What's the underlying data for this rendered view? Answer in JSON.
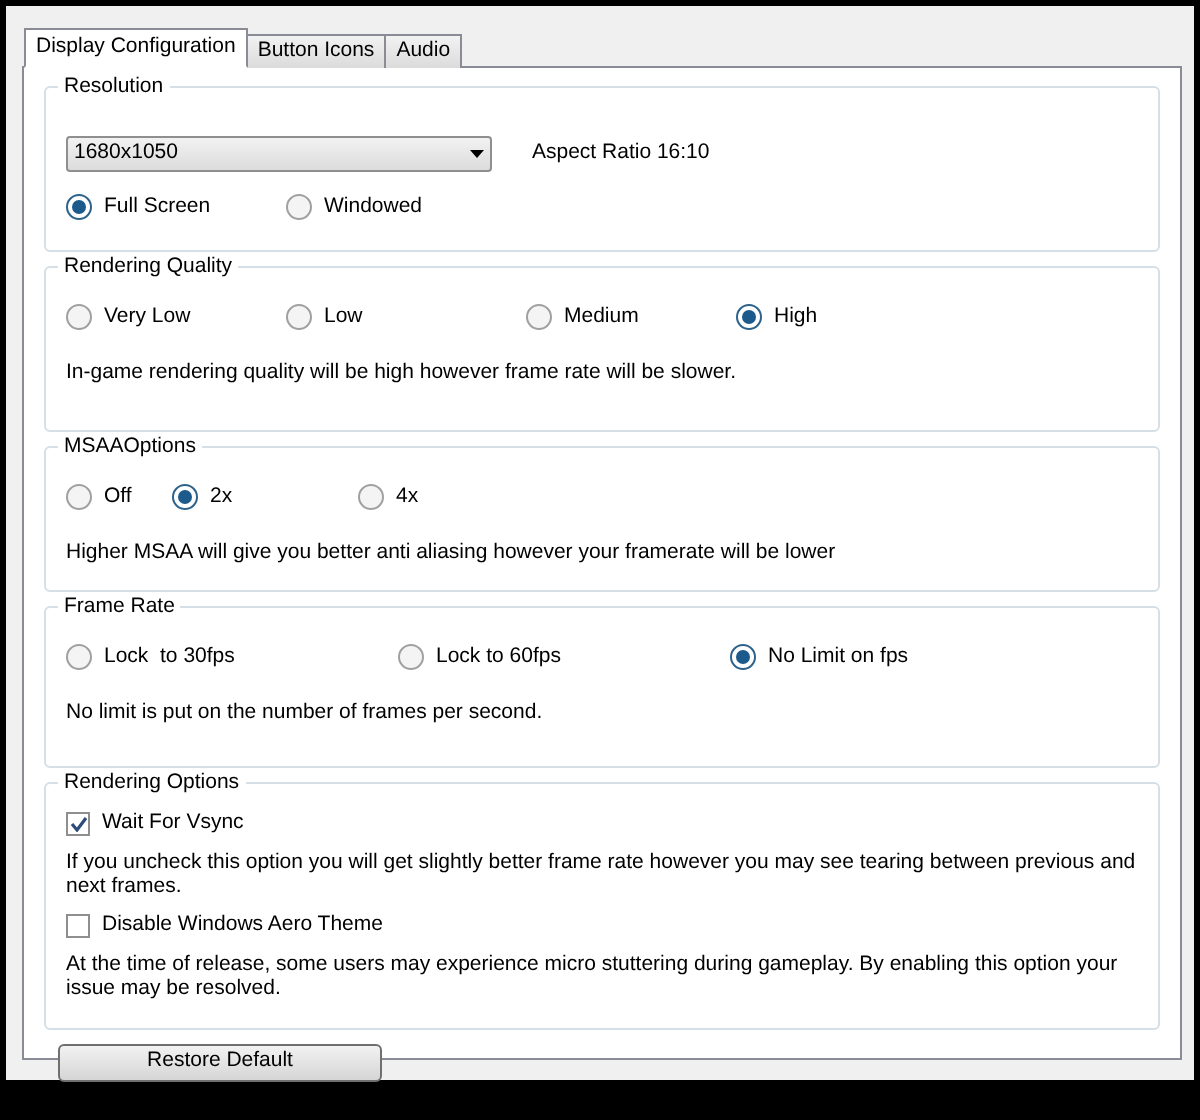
{
  "tabs": [
    {
      "label": "Display Configuration",
      "selected": true
    },
    {
      "label": "Button Icons",
      "selected": false
    },
    {
      "label": "Audio",
      "selected": false
    }
  ],
  "groups": [
    {
      "kind": "resolution",
      "title": "Resolution",
      "dropdown": {
        "value": "1680x1050"
      },
      "aspect": "Aspect Ratio 16:10",
      "options": [
        {
          "label": "Full Screen",
          "selected": true
        },
        {
          "label": "Windowed",
          "selected": false
        }
      ]
    },
    {
      "kind": "radio",
      "title": "Rendering Quality",
      "options": [
        {
          "label": "Very Low",
          "selected": false
        },
        {
          "label": "Low",
          "selected": false
        },
        {
          "label": "Medium",
          "selected": false
        },
        {
          "label": "High",
          "selected": true
        }
      ],
      "description": "In-game rendering quality will be high however frame rate will be slower."
    },
    {
      "kind": "radio",
      "title": "MSAAOptions",
      "options": [
        {
          "label": "Off",
          "selected": false
        },
        {
          "label": "2x",
          "selected": true
        },
        {
          "label": "4x",
          "selected": false
        }
      ],
      "description": "Higher MSAA will give you better anti aliasing however your framerate will be lower"
    },
    {
      "kind": "radio",
      "title": "Frame Rate",
      "options": [
        {
          "label": "Lock  to 30fps",
          "selected": false
        },
        {
          "label": "Lock to 60fps",
          "selected": false
        },
        {
          "label": "No Limit on fps",
          "selected": true
        }
      ],
      "description": "No limit is put on the number of frames per second."
    },
    {
      "kind": "checks",
      "title": "Rendering Options",
      "items": [
        {
          "label": "Wait For Vsync",
          "checked": true,
          "description": "If you uncheck this option you will get slightly better frame rate however you may see tearing between previous and next frames."
        },
        {
          "label": "Disable Windows Aero Theme",
          "checked": false,
          "description": "At the time of release, some users may experience micro stuttering during gameplay. By enabling this option your issue may be resolved."
        }
      ]
    }
  ],
  "restore_button": "Restore Default"
}
